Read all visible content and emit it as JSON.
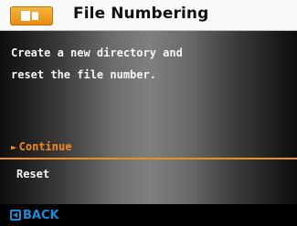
{
  "header": {
    "title": "File Numbering",
    "icon": "memory-card-icon"
  },
  "main": {
    "description": "Create a new directory and\nreset the file number.",
    "options": [
      {
        "label": "Continue",
        "selected": true
      },
      {
        "label": "Reset",
        "selected": false
      }
    ],
    "accent_color": "#f28a1c"
  },
  "footer": {
    "back_label": "BACK",
    "back_color": "#1d8ad6"
  }
}
